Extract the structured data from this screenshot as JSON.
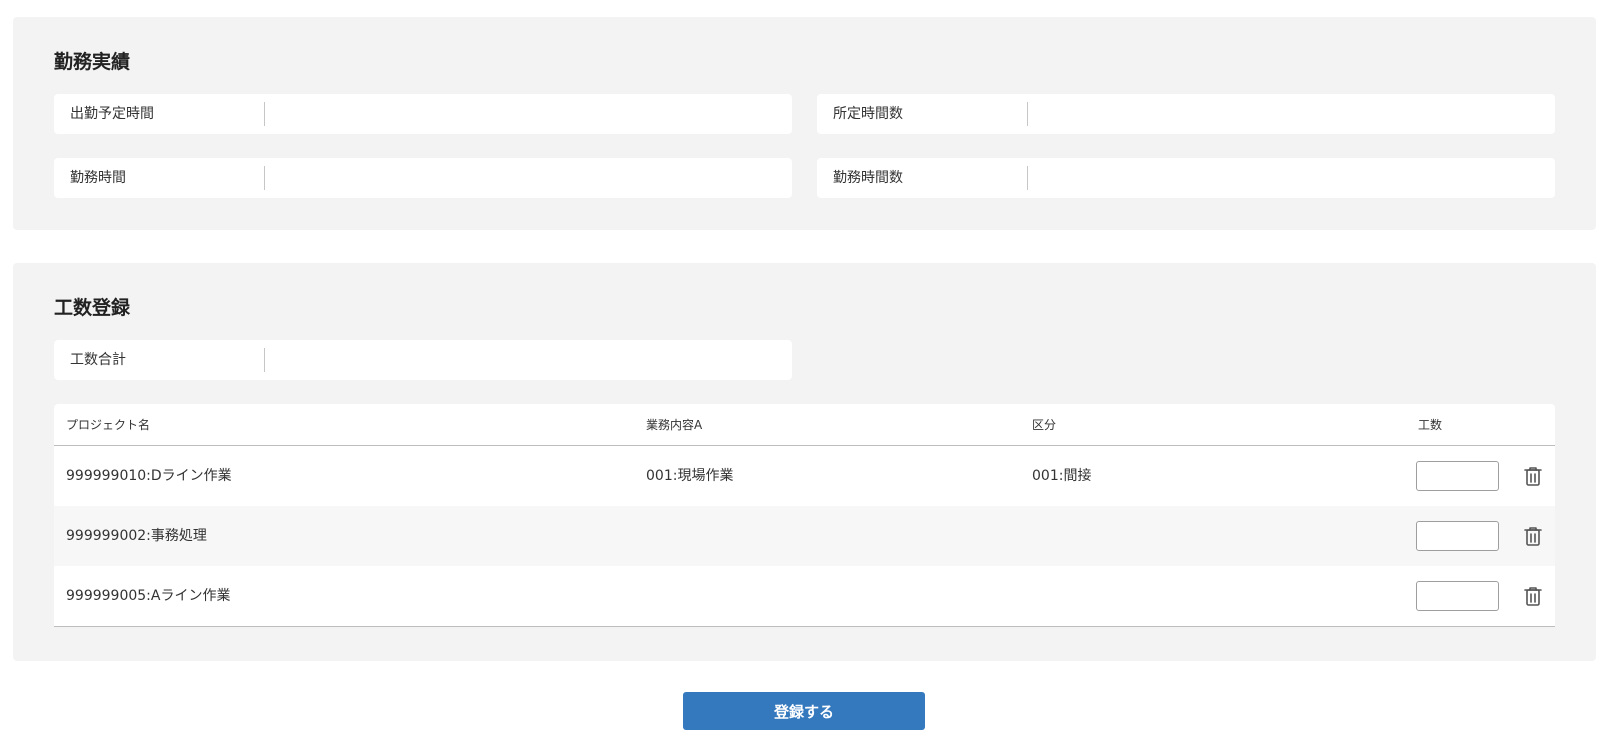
{
  "attendance": {
    "title": "勤務実績",
    "fields": [
      {
        "label": "出勤予定時間",
        "value": ""
      },
      {
        "label": "所定時間数",
        "value": ""
      },
      {
        "label": "勤務時間",
        "value": ""
      },
      {
        "label": "勤務時間数",
        "value": ""
      }
    ]
  },
  "manhour": {
    "title": "工数登録",
    "total": {
      "label": "工数合計",
      "value": ""
    },
    "table": {
      "headers": [
        "プロジェクト名",
        "業務内容A",
        "区分",
        "工数"
      ],
      "rows": [
        {
          "project": "999999010:Dライン作業",
          "task": "001:現場作業",
          "category": "001:間接",
          "hours": ""
        },
        {
          "project": "999999002:事務処理",
          "task": "",
          "category": "",
          "hours": ""
        },
        {
          "project": "999999005:Aライン作業",
          "task": "",
          "category": "",
          "hours": ""
        }
      ]
    }
  },
  "submit": {
    "label": "登録する"
  },
  "icons": {
    "delete": "trash-icon"
  },
  "colors": {
    "accent": "#3478be",
    "panel_bg": "#f3f3f3"
  }
}
